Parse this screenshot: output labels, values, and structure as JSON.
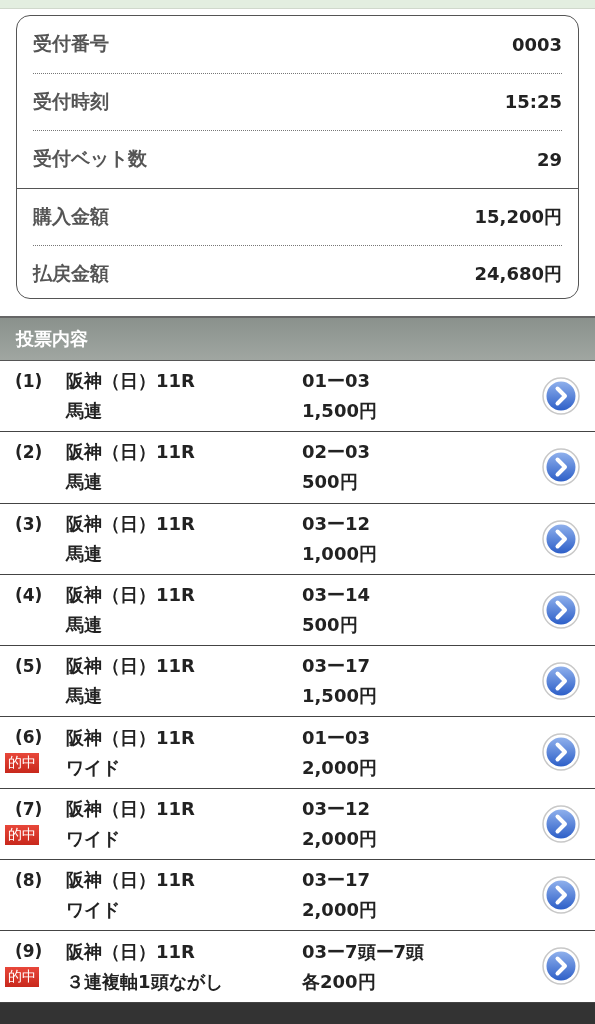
{
  "summary": {
    "groups": [
      [
        {
          "label": "受付番号",
          "value": "0003"
        },
        {
          "label": "受付時刻",
          "value": "15:25"
        },
        {
          "label": "受付ベット数",
          "value": "29"
        }
      ],
      [
        {
          "label": "購入金額",
          "value": "15,200円"
        },
        {
          "label": "払戻金額",
          "value": "24,680円"
        }
      ]
    ]
  },
  "section": {
    "title": "投票内容"
  },
  "bets": [
    {
      "no": "(1)",
      "race": "阪神（日）11R",
      "type": "馬連",
      "hit": false,
      "combo": "01ー03",
      "amount": "1,500円"
    },
    {
      "no": "(2)",
      "race": "阪神（日）11R",
      "type": "馬連",
      "hit": false,
      "combo": "02ー03",
      "amount": "500円"
    },
    {
      "no": "(3)",
      "race": "阪神（日）11R",
      "type": "馬連",
      "hit": false,
      "combo": "03ー12",
      "amount": "1,000円"
    },
    {
      "no": "(4)",
      "race": "阪神（日）11R",
      "type": "馬連",
      "hit": false,
      "combo": "03ー14",
      "amount": "500円"
    },
    {
      "no": "(5)",
      "race": "阪神（日）11R",
      "type": "馬連",
      "hit": false,
      "combo": "03ー17",
      "amount": "1,500円"
    },
    {
      "no": "(6)",
      "race": "阪神（日）11R",
      "type": "ワイド",
      "hit": true,
      "badge": "的中",
      "combo": "01ー03",
      "amount": "2,000円"
    },
    {
      "no": "(7)",
      "race": "阪神（日）11R",
      "type": "ワイド",
      "hit": true,
      "badge": "的中",
      "combo": "03ー12",
      "amount": "2,000円"
    },
    {
      "no": "(8)",
      "race": "阪神（日）11R",
      "type": "ワイド",
      "hit": false,
      "combo": "03ー17",
      "amount": "2,000円"
    },
    {
      "no": "(9)",
      "race": "阪神（日）11R",
      "type": "３連複軸1頭ながし",
      "hit": true,
      "badge": "的中",
      "combo": "03ー7頭ー7頭",
      "amount": "各200円"
    }
  ]
}
